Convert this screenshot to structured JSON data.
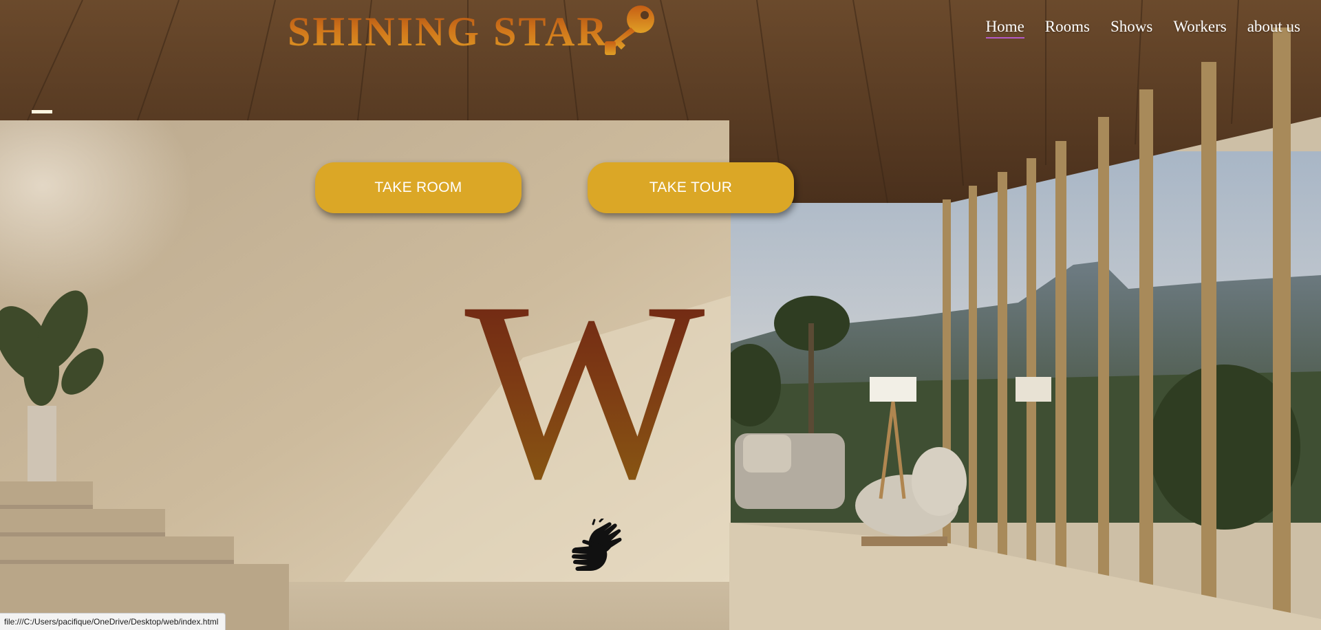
{
  "brand": {
    "name": "SHINING STAR",
    "colors": [
      "#a84a12",
      "#d0741a",
      "#e0a026"
    ],
    "icon": "key-icon"
  },
  "nav": {
    "items": [
      {
        "label": "Home",
        "active": true
      },
      {
        "label": "Rooms",
        "active": false
      },
      {
        "label": "Shows",
        "active": false
      },
      {
        "label": "Workers",
        "active": false
      },
      {
        "label": "about us",
        "active": false
      }
    ]
  },
  "actions": {
    "take_room": "TAKE ROOM",
    "take_tour": "TAKE TOUR",
    "button_color": "#dba726"
  },
  "hero": {
    "letter": "W",
    "letter_colors": [
      "#6e2414",
      "#8a5c12"
    ],
    "icon": "sign-language-hands-icon"
  },
  "status_bar": {
    "url": "file:///C:/Users/pacifique/OneDrive/Desktop/web/index.html"
  }
}
